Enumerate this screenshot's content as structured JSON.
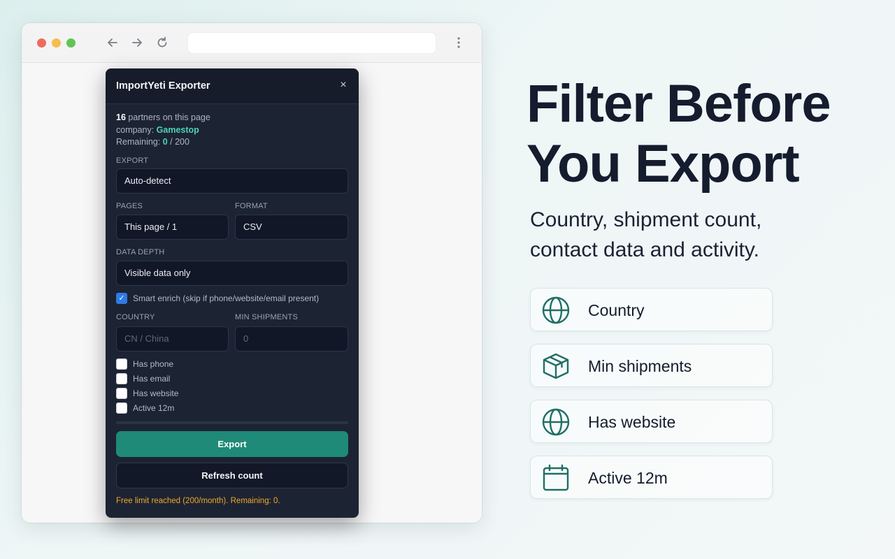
{
  "panel": {
    "title": "ImportYeti Exporter",
    "close": "×",
    "partners_count": "16",
    "partners_text": " partners on this page",
    "company_label": "company: ",
    "company_name": "Gamestop",
    "remaining_label": "Remaining: ",
    "remaining_value": "0",
    "remaining_total": " / 200",
    "export_label": "EXPORT",
    "export_value": "Auto-detect",
    "pages_label": "PAGES",
    "pages_value": "This page / 1",
    "format_label": "FORMAT",
    "format_value": "CSV",
    "depth_label": "DATA DEPTH",
    "depth_value": "Visible data only",
    "smart_enrich": "Smart enrich (skip if phone/website/email present)",
    "smart_enrich_checked": true,
    "country_label": "COUNTRY",
    "country_placeholder": "CN / China",
    "min_ship_label": "MIN SHIPMENTS",
    "min_ship_placeholder": "0",
    "checkboxes": [
      {
        "label": "Has phone",
        "checked": false
      },
      {
        "label": "Has email",
        "checked": false
      },
      {
        "label": "Has website",
        "checked": false
      },
      {
        "label": "Active 12m",
        "checked": false
      }
    ],
    "progress": 0,
    "export_button": "Export",
    "refresh_button": "Refresh count",
    "warning": "Free limit reached (200/month). Remaining: 0."
  },
  "marketing": {
    "headline_line1": "Filter Before",
    "headline_line2": "You Export",
    "subtitle_line1": "Country, shipment count,",
    "subtitle_line2": "contact data and activity.",
    "features": [
      {
        "label": "Country",
        "icon": "globe-icon"
      },
      {
        "label": "Min shipments",
        "icon": "box-icon"
      },
      {
        "label": "Has website",
        "icon": "globe-icon"
      },
      {
        "label": "Active 12m",
        "icon": "calendar-icon"
      }
    ],
    "accent_color": "#1f6f66"
  }
}
